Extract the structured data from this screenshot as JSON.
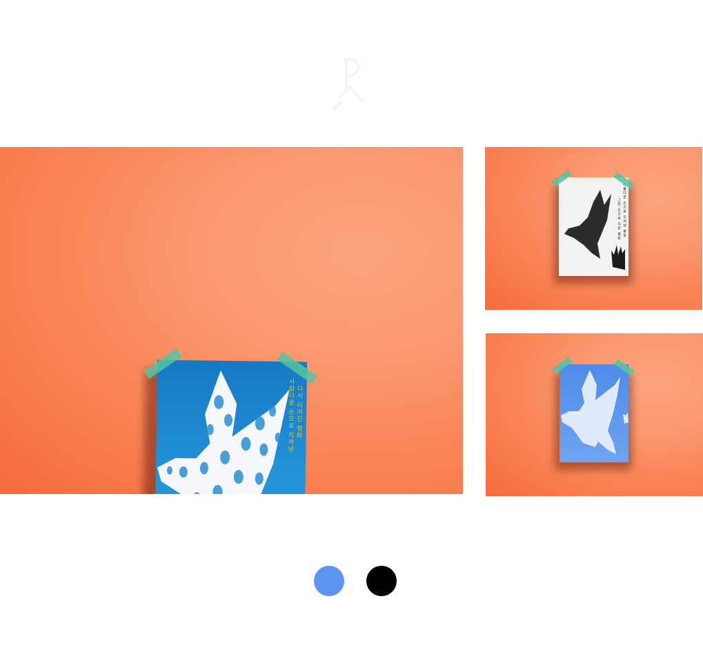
{
  "logo": {
    "icon": "pin-logo-icon"
  },
  "gallery": {
    "main": {
      "mockup": "blue-poster",
      "poster_text": [
        "사람다운 손으로 지켜낸",
        "다시 이어진 평화"
      ]
    },
    "thumbnails": [
      {
        "mockup": "white-poster",
        "poster_text": [
          "아름다운 손으로 지켜낸 평화",
          "그린 손으로 지은 평화",
          "평화"
        ]
      },
      {
        "mockup": "light-blue-poster"
      }
    ]
  },
  "color_options": [
    {
      "name": "blue",
      "color": "#5c96f2"
    },
    {
      "name": "black",
      "color": "#000000"
    }
  ],
  "colors": {
    "background": "#ffffff",
    "mockup_orange": "#fa8456",
    "poster_blue": "#1f88d0",
    "poster_light_blue": "#5a96e8",
    "poster_white": "#f2f2f0",
    "tape": "#56c4a0",
    "poster_accent": "#e8c32a"
  }
}
